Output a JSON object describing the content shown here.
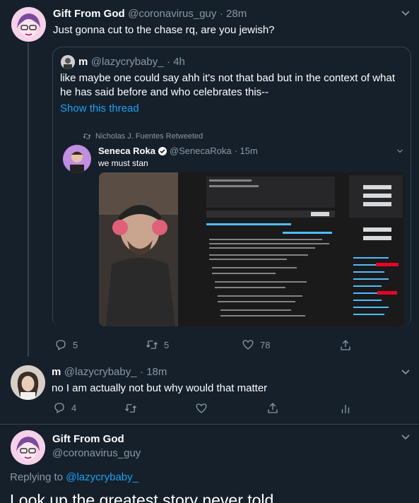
{
  "tweet1": {
    "display_name": "Gift From God",
    "handle": "@coronavirus_guy",
    "time": "· 28m",
    "text": "Just gonna cut to the chase rq, are you jewish?"
  },
  "quote": {
    "display_name": "m",
    "handle": "@lazycrybaby_",
    "time": "· 4h",
    "text": "like maybe one could say ahh it's not that bad but in the context of what he has said before and who celebrates this--",
    "show_thread": "Show this thread",
    "retweet_label": "Nicholas J. Fuentes Retweeted",
    "inner": {
      "display_name": "Seneca Roka",
      "handle": "@SenecaRoka",
      "time": "· 15m",
      "text": "we must stan"
    }
  },
  "tweet1_actions": {
    "replies": "5",
    "retweets": "5",
    "likes": "78"
  },
  "tweet2": {
    "display_name": "m",
    "handle": "@lazycrybaby_",
    "time": "· 18m",
    "text": "no I am actually not but why would that matter",
    "replies": "4"
  },
  "tweet3": {
    "display_name": "Gift From God",
    "handle": "@coronavirus_guy",
    "replying_prefix": "Replying to",
    "replying_to": "@lazycrybaby_",
    "text": "Look up the greatest story never told"
  },
  "colors": {
    "background": "#15202b",
    "link": "#1da1f2",
    "muted": "#8899a6",
    "border": "#38444d"
  }
}
